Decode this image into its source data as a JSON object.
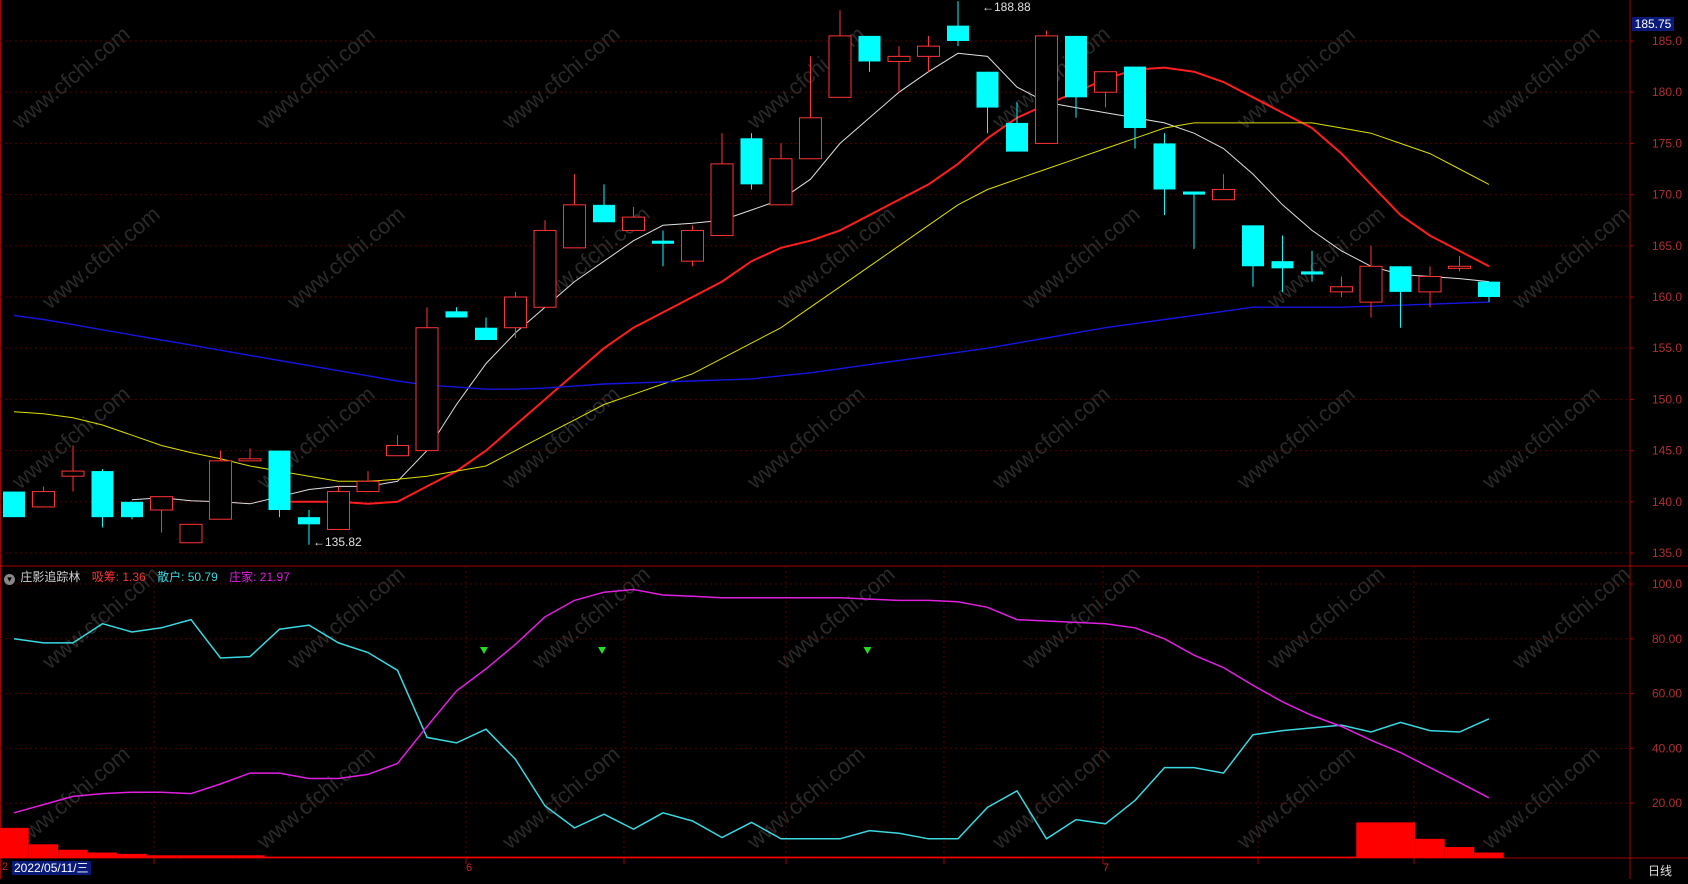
{
  "colors": {
    "background": "#000000",
    "grid": "#5a0000",
    "axis": "#aa0000",
    "tick_text": "#b03030",
    "up_candle": "#ff3333",
    "down_candle": "#00ffff",
    "ma5": "#e0e0e0",
    "ma10": "#ff1e1e",
    "ma20": "#dede00",
    "ma60": "#1515e0",
    "retail_line": "#3ad8e0",
    "banker_line": "#e020e0",
    "chip_bars": "#ff0000",
    "signal_marker": "#22dd22",
    "price_badge_bg": "#0a1a7a",
    "watermark": "#2a2a2a"
  },
  "watermark": "www.cfchi.com",
  "price_panel": {
    "current_price_badge": "185.75",
    "high_marker": "188.88",
    "low_marker": "135.82"
  },
  "indicator_panel": {
    "title": "庄影追踪林",
    "absorb_label": "吸筹: 1.36",
    "retail_label": "散户: 50.79",
    "banker_label": "庄家: 21.97"
  },
  "bottom_bar": {
    "date_label": "2022/05/11/三",
    "month_marks": [
      "6",
      "7"
    ],
    "left_mark": "2",
    "period_label": "日线"
  },
  "chart_data": [
    {
      "type": "candlestick",
      "title": "",
      "ylim": [
        133,
        187
      ],
      "y_ticks": [
        "185.0",
        "180.0",
        "175.0",
        "170.0",
        "165.0",
        "160.0",
        "155.0",
        "150.0",
        "145.0",
        "140.0",
        "135.0"
      ],
      "ohlc": [
        [
          141.0,
          141.0,
          138.5,
          138.5
        ],
        [
          139.5,
          141.5,
          139.5,
          141.0
        ],
        [
          142.5,
          145.5,
          141.0,
          143.0
        ],
        [
          143.0,
          143.2,
          137.5,
          138.5
        ],
        [
          140.0,
          140.0,
          138.3,
          138.5
        ],
        [
          139.2,
          140.5,
          137.0,
          140.5
        ],
        [
          136.0,
          137.8,
          136.0,
          137.8
        ],
        [
          138.3,
          145.0,
          138.3,
          144.0
        ],
        [
          144.0,
          145.2,
          144.0,
          144.2
        ],
        [
          145.0,
          145.0,
          138.5,
          139.2
        ],
        [
          138.5,
          139.2,
          135.8,
          137.8
        ],
        [
          137.3,
          141.5,
          137.3,
          141.0
        ],
        [
          141.0,
          143.0,
          141.0,
          142.0
        ],
        [
          144.5,
          146.5,
          144.5,
          145.5
        ],
        [
          145.0,
          159.0,
          145.0,
          157.0
        ],
        [
          158.6,
          159.0,
          158.4,
          158.0
        ],
        [
          157.0,
          158.0,
          156.0,
          155.8
        ],
        [
          157.0,
          160.5,
          156.0,
          160.0
        ],
        [
          159.0,
          167.5,
          159.0,
          166.5
        ],
        [
          164.8,
          172.0,
          164.8,
          169.0
        ],
        [
          169.0,
          171.0,
          167.5,
          167.3
        ],
        [
          166.5,
          168.8,
          166.5,
          167.8
        ],
        [
          165.5,
          166.5,
          163.0,
          165.2
        ],
        [
          163.5,
          167.0,
          163.0,
          166.5
        ],
        [
          166.0,
          176.0,
          166.0,
          173.0
        ],
        [
          175.5,
          176.0,
          170.5,
          171.0
        ],
        [
          169.0,
          175.0,
          169.0,
          173.5
        ],
        [
          173.5,
          183.5,
          173.5,
          177.5
        ],
        [
          179.5,
          188.0,
          179.5,
          185.5
        ],
        [
          185.5,
          185.5,
          182.0,
          183.0
        ],
        [
          183.0,
          184.5,
          180.0,
          183.5
        ],
        [
          183.5,
          185.5,
          182.0,
          184.5
        ],
        [
          186.5,
          188.9,
          184.5,
          185.0
        ],
        [
          182.0,
          182.0,
          176.0,
          178.5
        ],
        [
          177.0,
          179.0,
          175.0,
          174.2
        ],
        [
          175.0,
          186.0,
          175.0,
          185.5
        ],
        [
          185.5,
          185.5,
          177.5,
          179.5
        ],
        [
          180.0,
          182.0,
          178.5,
          182.0
        ],
        [
          182.5,
          182.5,
          174.5,
          176.5
        ],
        [
          175.0,
          176.0,
          168.0,
          170.5
        ],
        [
          170.3,
          170.3,
          164.7,
          170.0
        ],
        [
          169.5,
          172.0,
          169.5,
          170.5
        ],
        [
          167.0,
          167.0,
          161.0,
          163.0
        ],
        [
          163.5,
          166.0,
          160.5,
          162.8
        ],
        [
          162.5,
          164.5,
          161.5,
          162.2
        ],
        [
          160.5,
          162.0,
          160.0,
          161.0
        ],
        [
          159.5,
          165.0,
          158.0,
          163.0
        ],
        [
          163.0,
          163.0,
          157.0,
          160.5
        ],
        [
          160.5,
          163.0,
          159.0,
          162.0
        ],
        [
          162.8,
          164.0,
          162.5,
          163.0
        ],
        [
          161.5,
          161.5,
          159.5,
          160.0
        ]
      ],
      "series": [
        {
          "name": "MA5",
          "values": [
            null,
            null,
            null,
            null,
            140.2,
            140.4,
            140.1,
            140.0,
            139.8,
            140.5,
            141.2,
            141.5,
            141.5,
            142.0,
            145.0,
            149.5,
            153.5,
            156.5,
            159.0,
            161.5,
            163.5,
            165.5,
            167.0,
            167.2,
            167.5,
            168.5,
            169.5,
            171.5,
            175.0,
            177.5,
            180.0,
            182.0,
            183.8,
            183.5,
            180.5,
            179.0,
            178.5,
            178.0,
            177.5,
            177.0,
            176.0,
            174.5,
            172.0,
            169.0,
            166.5,
            164.5,
            163.0,
            162.2,
            162.0,
            161.8,
            161.5
          ]
        },
        {
          "name": "MA10",
          "values": [
            null,
            null,
            null,
            null,
            null,
            null,
            null,
            null,
            null,
            140.0,
            140.0,
            140.0,
            139.8,
            140.0,
            141.5,
            143.0,
            145.0,
            147.5,
            150.0,
            152.5,
            155.0,
            157.0,
            158.5,
            160.0,
            161.5,
            163.5,
            164.8,
            165.5,
            166.5,
            168.0,
            169.5,
            171.0,
            173.0,
            175.5,
            177.5,
            178.8,
            180.0,
            181.3,
            182.2,
            182.4,
            182.0,
            181.0,
            179.5,
            178.0,
            176.5,
            174.0,
            171.0,
            168.0,
            166.0,
            164.5,
            163.0
          ]
        },
        {
          "name": "MA20",
          "values": [
            148.8,
            148.6,
            148.2,
            147.5,
            146.5,
            145.5,
            144.8,
            144.2,
            143.5,
            143.0,
            142.5,
            142.0,
            142.0,
            142.2,
            142.5,
            143.0,
            143.5,
            145.0,
            146.5,
            148.0,
            149.5,
            150.5,
            151.5,
            152.5,
            154.0,
            155.5,
            157.0,
            159.0,
            161.0,
            163.0,
            165.0,
            167.0,
            169.0,
            170.5,
            171.5,
            172.5,
            173.5,
            174.5,
            175.5,
            176.5,
            177.0,
            177.0,
            177.0,
            177.0,
            177.0,
            176.5,
            176.0,
            175.0,
            174.0,
            172.5,
            171.0
          ]
        },
        {
          "name": "MA60",
          "values": [
            158.2,
            157.8,
            157.3,
            156.8,
            156.3,
            155.8,
            155.3,
            154.8,
            154.3,
            153.8,
            153.3,
            152.8,
            152.3,
            151.8,
            151.4,
            151.2,
            151.0,
            151.0,
            151.1,
            151.3,
            151.5,
            151.6,
            151.7,
            151.8,
            151.9,
            152.0,
            152.3,
            152.6,
            153.0,
            153.4,
            153.8,
            154.2,
            154.6,
            155.0,
            155.5,
            156.0,
            156.5,
            157.0,
            157.4,
            157.8,
            158.2,
            158.6,
            159.0,
            159.0,
            159.0,
            159.0,
            159.1,
            159.2,
            159.3,
            159.4,
            159.5
          ]
        }
      ]
    },
    {
      "type": "line",
      "title": "庄影追踪林",
      "ylim": [
        0,
        105
      ],
      "y_ticks": [
        "100.0",
        "80.00",
        "60.00",
        "40.00",
        "20.00"
      ],
      "series": [
        {
          "name": "散户",
          "values": [
            80,
            78.5,
            78.5,
            85.5,
            82.5,
            84,
            87,
            73,
            73.5,
            83.5,
            85,
            78.5,
            75,
            68.5,
            44,
            42,
            47,
            36,
            19,
            11,
            16,
            10.5,
            16.5,
            13.5,
            7.5,
            13,
            7,
            7,
            7,
            10,
            9,
            7,
            7,
            18.5,
            24.5,
            7,
            14,
            12.5,
            21,
            33,
            33,
            31,
            45,
            46.5,
            47.5,
            48.5,
            46,
            49.5,
            46.5,
            46,
            50.79
          ]
        },
        {
          "name": "庄家",
          "values": [
            16.5,
            19.5,
            22.5,
            23.5,
            24,
            24,
            23.5,
            27,
            31,
            31,
            29,
            29,
            30.5,
            34.5,
            48,
            61,
            69,
            78,
            88,
            94,
            97,
            98,
            96,
            95.5,
            95,
            95,
            95,
            95,
            95,
            94.5,
            94,
            94,
            93.5,
            91.5,
            87,
            86.5,
            86,
            85.5,
            84,
            80,
            74,
            69.5,
            63,
            57,
            52,
            48,
            43,
            38.5,
            33,
            27.5,
            21.97
          ]
        }
      ],
      "chip_bars": [
        11,
        5,
        3,
        2,
        1.5,
        1,
        1,
        1,
        1,
        0.5,
        0.5,
        0.5,
        0.5,
        0.5,
        0.5,
        0.5,
        0.5,
        0.5,
        0.5,
        0.5,
        0.5,
        0.5,
        0.5,
        0.5,
        0.5,
        0.5,
        0.5,
        0.5,
        0.5,
        0.5,
        0.5,
        0.5,
        0.5,
        0.5,
        0.5,
        0.5,
        0.5,
        0.5,
        0.5,
        0.5,
        0.5,
        0.5,
        0.5,
        0.5,
        0.5,
        0.5,
        13,
        13,
        7,
        4,
        2
      ],
      "signal_markers": [
        16,
        20,
        29
      ]
    }
  ]
}
